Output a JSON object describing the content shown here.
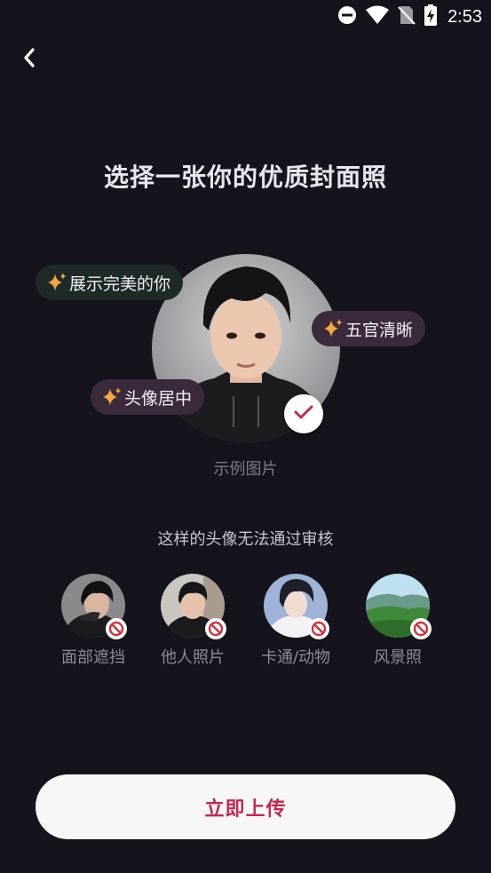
{
  "status_bar": {
    "time": "2:53",
    "icons": [
      "do-not-disturb-icon",
      "wifi-icon",
      "no-sim-icon",
      "battery-charging-icon"
    ]
  },
  "header": {
    "back_icon": "chevron-left-icon",
    "title": "选择一张你的优质封面照"
  },
  "sample": {
    "tags": [
      "展示完美的你",
      "五官清晰",
      "头像居中"
    ],
    "caption": "示例图片",
    "check_icon": "checkmark-icon"
  },
  "rejections": {
    "title": "这样的头像无法通过审核",
    "items": [
      {
        "label": "面部遮挡",
        "icon": "prohibited-icon"
      },
      {
        "label": "他人照片",
        "icon": "prohibited-icon"
      },
      {
        "label": "卡通/动物",
        "icon": "prohibited-icon"
      },
      {
        "label": "风景照",
        "icon": "prohibited-icon"
      }
    ]
  },
  "upload_button": {
    "label": "立即上传"
  },
  "colors": {
    "background": "#15131c",
    "accent": "#c2294f",
    "sparkle": "#f4a640",
    "prohibited": "#d0323c"
  }
}
